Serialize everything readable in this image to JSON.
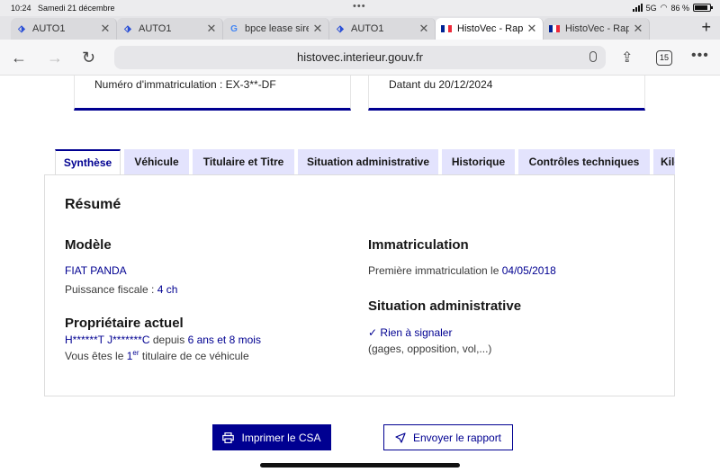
{
  "status_bar": {
    "time": "10:24",
    "date": "Samedi 21 décembre",
    "network": "5G",
    "battery": "86 %",
    "battery_level": 0.86
  },
  "browser_tabs": [
    {
      "title": "AUTO1",
      "favicon": "auto1-logo-icon",
      "active": false
    },
    {
      "title": "AUTO1",
      "favicon": "auto1-logo-icon",
      "active": false
    },
    {
      "title": "bpce lease sire",
      "favicon": "google-icon",
      "active": false
    },
    {
      "title": "AUTO1",
      "favicon": "auto1-logo-icon",
      "active": false
    },
    {
      "title": "HistoVec - Rapp",
      "favicon": "french-flag-icon",
      "active": true
    },
    {
      "title": "HistoVec - Rapp",
      "favicon": "french-flag-icon",
      "active": false
    }
  ],
  "address_bar": {
    "url": "histovec.interieur.gouv.fr",
    "tab_count": "15"
  },
  "top_cards": {
    "immatriculation": "Numéro d'immatriculation : EX-3**-DF",
    "datant": "Datant du 20/12/2024"
  },
  "page_tabs": [
    {
      "label": "Synthèse",
      "active": true
    },
    {
      "label": "Véhicule",
      "active": false
    },
    {
      "label": "Titulaire et Titre",
      "active": false
    },
    {
      "label": "Situation administrative",
      "active": false
    },
    {
      "label": "Historique",
      "active": false
    },
    {
      "label": "Contrôles techniques",
      "active": false
    },
    {
      "label": "Kilo",
      "active": false
    }
  ],
  "summary": {
    "title": "Résumé",
    "modele": {
      "heading": "Modèle",
      "name": "FIAT PANDA",
      "puissance_label": "Puissance fiscale :",
      "puissance_value": "4 ch"
    },
    "proprietaire": {
      "heading": "Propriétaire actuel",
      "name": "H******T J*******C",
      "depuis_label": "depuis",
      "depuis_value": "6 ans et 8 mois",
      "titulaire_prefix": "Vous êtes le",
      "rank_number": "1",
      "rank_suffix": "er",
      "titulaire_suffix": "titulaire de ce véhicule"
    },
    "immatriculation": {
      "heading": "Immatriculation",
      "first_label": "Première immatriculation le",
      "first_date": "04/05/2018"
    },
    "situation": {
      "heading": "Situation administrative",
      "status": "Rien à signaler",
      "note": "(gages, opposition, vol,...)"
    }
  },
  "actions": {
    "print_label": "Imprimer le CSA",
    "send_label": "Envoyer le rapport"
  },
  "colors": {
    "brand_blue": "#000091",
    "tab_bg": "#e3e3fd"
  }
}
